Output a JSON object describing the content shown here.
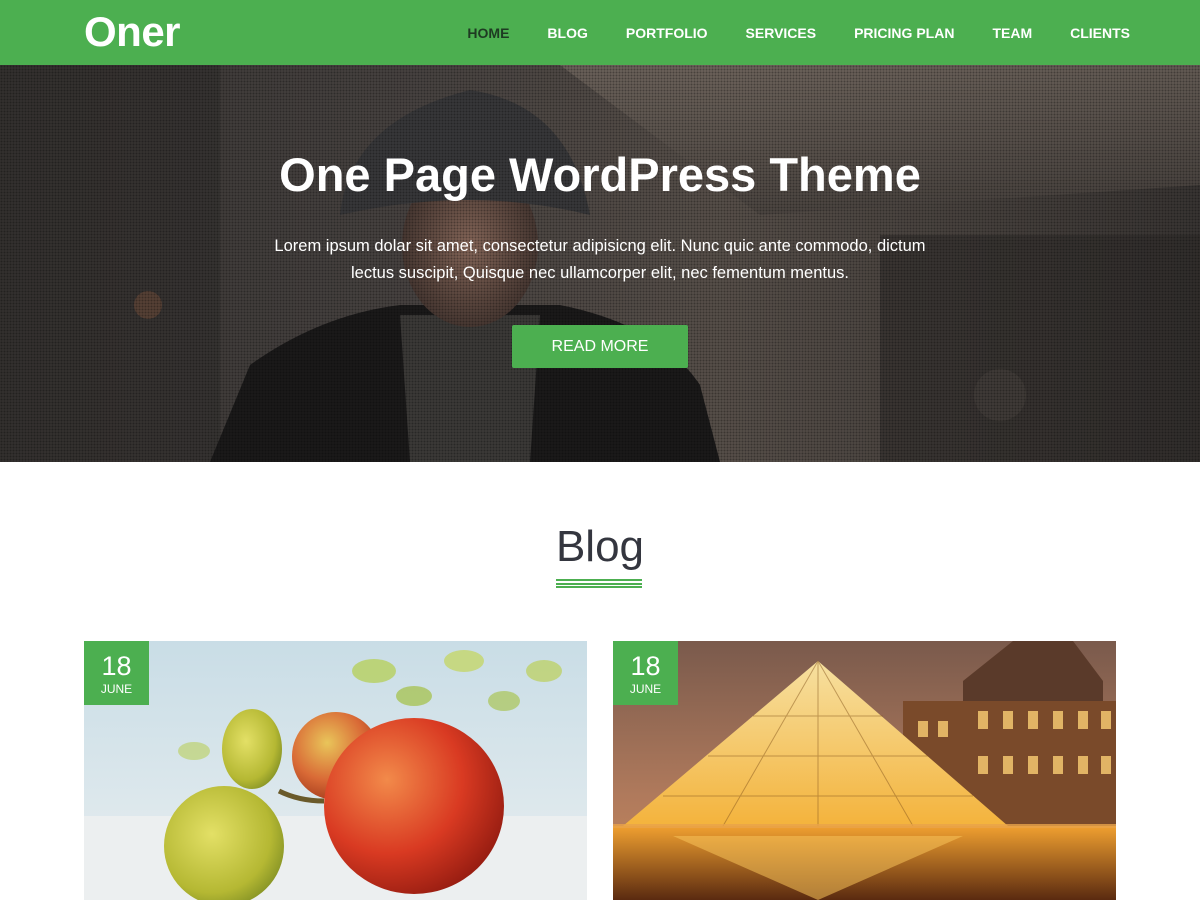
{
  "header": {
    "logo": "Oner",
    "nav": [
      {
        "label": "HOME",
        "active": true
      },
      {
        "label": "BLOG"
      },
      {
        "label": "PORTFOLIO"
      },
      {
        "label": "SERVICES"
      },
      {
        "label": "PRICING PLAN"
      },
      {
        "label": "TEAM"
      },
      {
        "label": "CLIENTS"
      }
    ]
  },
  "hero": {
    "title": "One Page WordPress Theme",
    "text": "Lorem ipsum dolar sit amet, consectetur adipisicng elit. Nunc quic ante commodo, dictum lectus suscipit, Quisque nec ullamcorper elit, nec fementum mentus.",
    "button_label": "READ MORE"
  },
  "blog": {
    "title": "Blog",
    "posts": [
      {
        "day": "18",
        "month": "JUNE",
        "image": "apples-photo"
      },
      {
        "day": "18",
        "month": "JUNE",
        "image": "louvre-pyramid-photo"
      }
    ]
  },
  "colors": {
    "accent": "#4caf50",
    "active_nav": "#1e3a22",
    "heading": "#34363f"
  }
}
